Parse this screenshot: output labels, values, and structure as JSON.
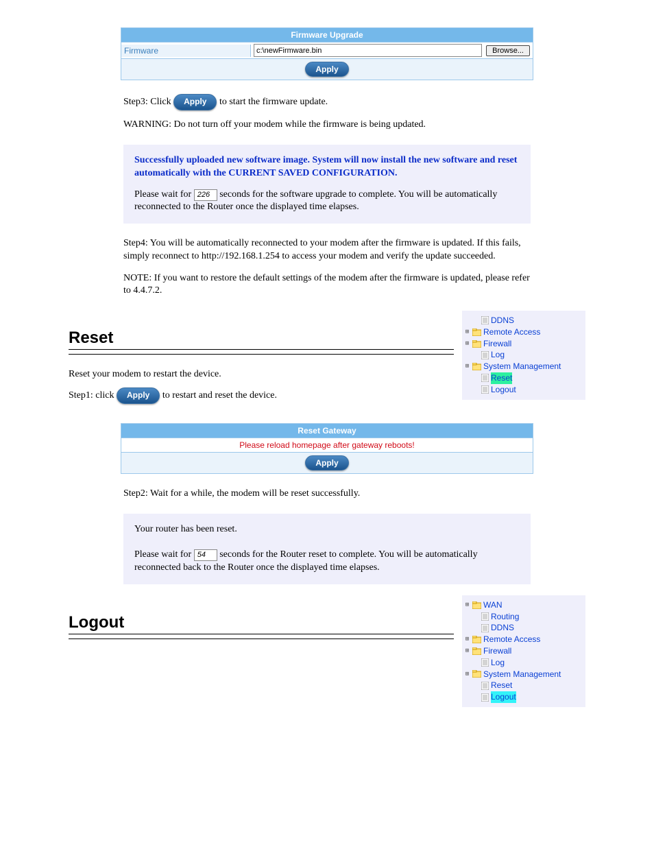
{
  "firmware_panel": {
    "title": "Firmware Upgrade",
    "row_label": "Firmware",
    "file_value": "c:\\newFirmware.bin",
    "browse_label": "Browse...",
    "apply_label": "Apply"
  },
  "body1": {
    "pre": "Step3: Click ",
    "btn": "Apply",
    "post": " to start the firmware update.",
    "warn": "WARNING: Do not turn off your modem while the firmware is being updated."
  },
  "upload_notice": {
    "headline": "Successfully uploaded new software image. System will now install the new software and reset automatically with the CURRENT SAVED CONFIGURATION.",
    "pre": "Please wait for ",
    "seconds": "226",
    "post": " seconds for the software upgrade to complete. You will be automatically reconnected to the Router once the displayed time elapses."
  },
  "body2": {
    "line1": "Step4: You will be automatically reconnected to your modem after the firmware is updated. If this fails, simply reconnect to http://192.168.1.254 to access your modem and verify the update succeeded.",
    "line2": "NOTE: If you want to restore the default settings of the modem after the firmware is updated, please refer to 4.4.7.2."
  },
  "reset_section": {
    "heading": "Reset",
    "desc": "Reset your modem to restart the device.",
    "step_pre": "Step1: click ",
    "step_btn": "Apply",
    "step_post": " to restart and reset the device.",
    "panel_title": "Reset Gateway",
    "panel_msg": "Please reload homepage after gateway reboots!",
    "panel_apply": "Apply",
    "desc2": "Step2: Wait for a while, the modem will be reset successfully."
  },
  "reset_notice": {
    "headline": "Your router has been reset.",
    "pre": "Please wait for ",
    "seconds": "54",
    "post": " seconds for the Router reset to complete. You will be automatically reconnected back to the Router once the displayed time elapses."
  },
  "logout_section": {
    "heading": "Logout"
  },
  "tree1": {
    "items": [
      {
        "indent": 1,
        "toggler": "",
        "icon": "doc",
        "label": "DDNS",
        "hl": ""
      },
      {
        "indent": 0,
        "toggler": "+",
        "icon": "folder",
        "label": "Remote Access",
        "hl": ""
      },
      {
        "indent": 0,
        "toggler": "+",
        "icon": "folder",
        "label": "Firewall",
        "hl": ""
      },
      {
        "indent": 1,
        "toggler": "",
        "icon": "doc",
        "label": "Log",
        "hl": ""
      },
      {
        "indent": 0,
        "toggler": "+",
        "icon": "folder",
        "label": "System Management",
        "hl": ""
      },
      {
        "indent": 1,
        "toggler": "",
        "icon": "doc",
        "label": "Reset",
        "hl": "green"
      },
      {
        "indent": 1,
        "toggler": "",
        "icon": "doc",
        "label": "Logout",
        "hl": ""
      }
    ]
  },
  "tree2": {
    "items": [
      {
        "indent": 0,
        "toggler": "+",
        "icon": "folder",
        "label": "WAN",
        "hl": ""
      },
      {
        "indent": 1,
        "toggler": "",
        "icon": "doc",
        "label": "Routing",
        "hl": ""
      },
      {
        "indent": 1,
        "toggler": "",
        "icon": "doc",
        "label": "DDNS",
        "hl": ""
      },
      {
        "indent": 0,
        "toggler": "+",
        "icon": "folder",
        "label": "Remote Access",
        "hl": ""
      },
      {
        "indent": 0,
        "toggler": "+",
        "icon": "folder",
        "label": "Firewall",
        "hl": ""
      },
      {
        "indent": 1,
        "toggler": "",
        "icon": "doc",
        "label": "Log",
        "hl": ""
      },
      {
        "indent": 0,
        "toggler": "+",
        "icon": "folder",
        "label": "System Management",
        "hl": ""
      },
      {
        "indent": 1,
        "toggler": "",
        "icon": "doc",
        "label": "Reset",
        "hl": ""
      },
      {
        "indent": 1,
        "toggler": "",
        "icon": "doc",
        "label": "Logout",
        "hl": "cyan"
      }
    ]
  }
}
